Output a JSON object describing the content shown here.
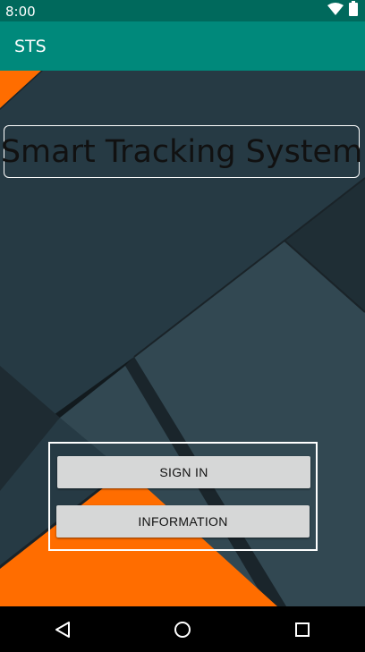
{
  "status_bar": {
    "time": "8:00",
    "icons": [
      "wifi-icon",
      "battery-icon"
    ]
  },
  "app_bar": {
    "title": "STS"
  },
  "main": {
    "heading": "Smart Tracking System",
    "buttons": {
      "sign_in_label": "SIGN IN",
      "information_label": "INFORMATION"
    }
  },
  "nav_bar": {
    "icons": [
      "back-icon",
      "home-icon",
      "recents-icon"
    ]
  },
  "colors": {
    "status_bar": "#00695c",
    "app_bar": "#00897b",
    "accent_orange": "#ff6d00",
    "background_dark": "#263a44",
    "button": "#d6d7d7"
  }
}
